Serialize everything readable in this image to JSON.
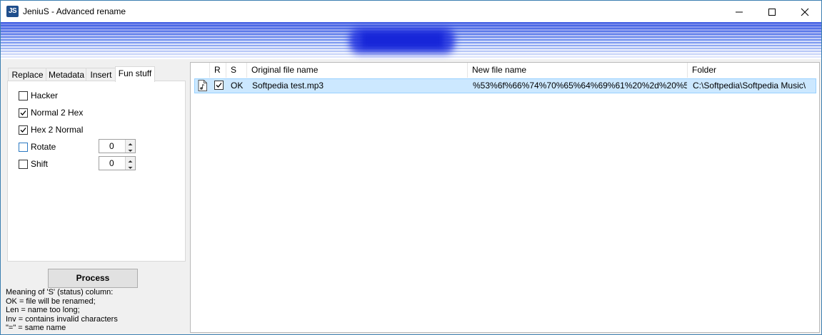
{
  "window": {
    "title": "JeniuS - Advanced rename",
    "icon_text": "JS",
    "controls": [
      "minimize-icon",
      "maximize-icon",
      "close-icon"
    ]
  },
  "tabs": [
    {
      "label": "Replace",
      "active": false
    },
    {
      "label": "Metadata",
      "active": false
    },
    {
      "label": "Insert",
      "active": false
    },
    {
      "label": "Fun stuff",
      "active": true
    }
  ],
  "fun_stuff": {
    "options": [
      {
        "label": "Hacker",
        "checked": false
      },
      {
        "label": "Normal 2 Hex",
        "checked": true
      },
      {
        "label": "Hex 2 Normal",
        "checked": true
      },
      {
        "label": "Rotate",
        "checked": false,
        "spinner": "0"
      },
      {
        "label": "Shift",
        "checked": false,
        "spinner": "0"
      }
    ]
  },
  "process_label": "Process",
  "legend": [
    "Meaning of 'S' (status) column:",
    "OK = file will be renamed;",
    "Len = name too long;",
    "Inv = contains invalid characters",
    "\"=\" = same name"
  ],
  "file_list": {
    "columns": [
      "",
      "R",
      "S",
      "Original file name",
      "New file name",
      "Folder"
    ],
    "rows": [
      {
        "icon": "music-file-icon",
        "rename": true,
        "status": "OK",
        "original": "Softpedia test.mp3",
        "new_name": "%53%6f%66%74%70%65%64%69%61%20%2d%20%5...",
        "folder": "C:\\Softpedia\\Softpedia Music\\"
      }
    ]
  },
  "colors": {
    "accent": "#3c7fb1",
    "selection": "#cce8ff",
    "banner": "#2536e0"
  }
}
